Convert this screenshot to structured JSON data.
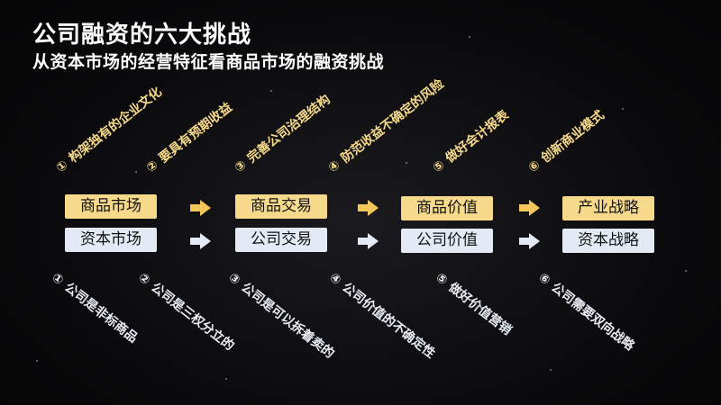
{
  "title": "公司融资的六大挑战",
  "subtitle": "从资本市场的经营特征看商品市场的融资挑战",
  "top_items": [
    {
      "num": "①",
      "text": "构架独有的企业文化"
    },
    {
      "num": "②",
      "text": "要具有预期收益"
    },
    {
      "num": "③",
      "text": "完善公司治理结构"
    },
    {
      "num": "④",
      "text": "防范收益不确定的风险"
    },
    {
      "num": "⑤",
      "text": "做好会计报表"
    },
    {
      "num": "⑥",
      "text": "创新商业模式"
    }
  ],
  "bottom_items": [
    {
      "num": "①",
      "text": "公司是非标商品"
    },
    {
      "num": "②",
      "text": "公司是三权分立的"
    },
    {
      "num": "③",
      "text": "公司是可以拆着卖的"
    },
    {
      "num": "④",
      "text": "公司价值的不确定性"
    },
    {
      "num": "⑤",
      "text": "做好价值营销"
    },
    {
      "num": "⑥",
      "text": "公司需要双向战略"
    }
  ],
  "columns": [
    {
      "gold": "商品市场",
      "white": "资本市场"
    },
    {
      "gold": "商品交易",
      "white": "公司交易"
    },
    {
      "gold": "商品价值",
      "white": "公司价值"
    },
    {
      "gold": "产业战略",
      "white": "资本战略"
    }
  ],
  "colors": {
    "gold": "#f6d98a",
    "gold_arrow": "#f3c75a",
    "pale": "#e4eaf5",
    "background": "#0b0b0d"
  },
  "icons": {
    "arrow": "right-arrow-icon"
  }
}
